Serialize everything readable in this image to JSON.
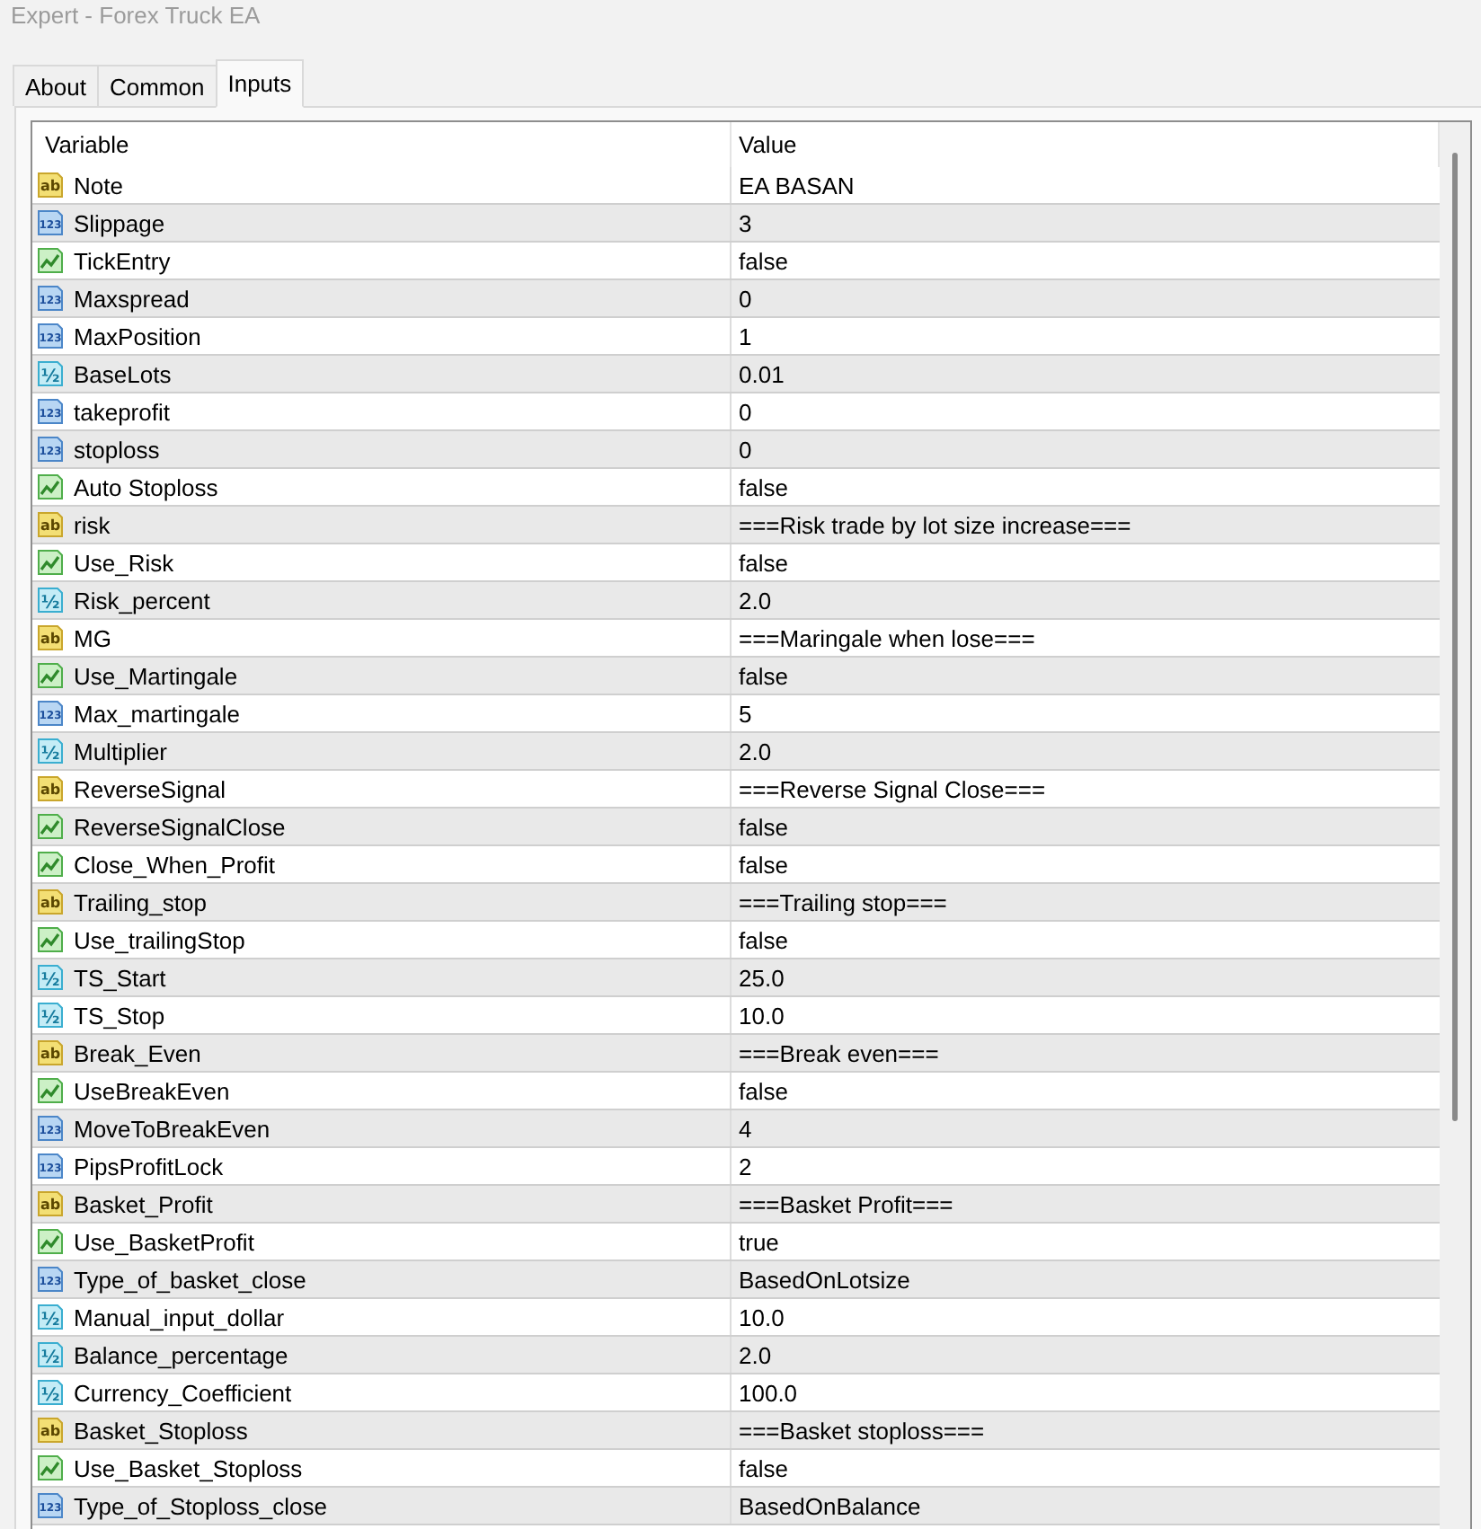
{
  "window": {
    "title": "Expert - Forex Truck EA"
  },
  "tabs": [
    {
      "label": "About",
      "selected": false
    },
    {
      "label": "Common",
      "selected": false
    },
    {
      "label": "Inputs",
      "selected": true
    }
  ],
  "table": {
    "columns": [
      "Variable",
      "Value"
    ],
    "rows": [
      {
        "kind": "string",
        "icon_text": "ab",
        "variable": "Note",
        "value": "EA BASAN"
      },
      {
        "kind": "int",
        "icon_text": "123",
        "variable": "Slippage",
        "value": "3"
      },
      {
        "kind": "bool",
        "variable": "TickEntry",
        "value": "false"
      },
      {
        "kind": "int",
        "icon_text": "123",
        "variable": "Maxspread",
        "value": "0"
      },
      {
        "kind": "int",
        "icon_text": "123",
        "variable": "MaxPosition",
        "value": "1"
      },
      {
        "kind": "double",
        "icon_text": "½",
        "variable": "BaseLots",
        "value": "0.01"
      },
      {
        "kind": "int",
        "icon_text": "123",
        "variable": "takeprofit",
        "value": "0"
      },
      {
        "kind": "int",
        "icon_text": "123",
        "variable": "stoploss",
        "value": "0"
      },
      {
        "kind": "bool",
        "variable": "Auto Stoploss",
        "value": "false"
      },
      {
        "kind": "string",
        "icon_text": "ab",
        "variable": "risk",
        "value": "===Risk trade by lot size increase==="
      },
      {
        "kind": "bool",
        "variable": "Use_Risk",
        "value": "false"
      },
      {
        "kind": "double",
        "icon_text": "½",
        "variable": "Risk_percent",
        "value": "2.0"
      },
      {
        "kind": "string",
        "icon_text": "ab",
        "variable": "MG",
        "value": "===Maringale when lose==="
      },
      {
        "kind": "bool",
        "variable": "Use_Martingale",
        "value": "false"
      },
      {
        "kind": "int",
        "icon_text": "123",
        "variable": "Max_martingale",
        "value": "5"
      },
      {
        "kind": "double",
        "icon_text": "½",
        "variable": "Multiplier",
        "value": "2.0"
      },
      {
        "kind": "string",
        "icon_text": "ab",
        "variable": "ReverseSignal",
        "value": "===Reverse Signal Close==="
      },
      {
        "kind": "bool",
        "variable": "ReverseSignalClose",
        "value": "false"
      },
      {
        "kind": "bool",
        "variable": "Close_When_Profit",
        "value": "false"
      },
      {
        "kind": "string",
        "icon_text": "ab",
        "variable": "Trailing_stop",
        "value": "===Trailing stop==="
      },
      {
        "kind": "bool",
        "variable": "Use_trailingStop",
        "value": "false"
      },
      {
        "kind": "double",
        "icon_text": "½",
        "variable": "TS_Start",
        "value": "25.0"
      },
      {
        "kind": "double",
        "icon_text": "½",
        "variable": "TS_Stop",
        "value": "10.0"
      },
      {
        "kind": "string",
        "icon_text": "ab",
        "variable": "Break_Even",
        "value": "===Break even==="
      },
      {
        "kind": "bool",
        "variable": "UseBreakEven",
        "value": "false"
      },
      {
        "kind": "int",
        "icon_text": "123",
        "variable": "MoveToBreakEven",
        "value": "4"
      },
      {
        "kind": "int",
        "icon_text": "123",
        "variable": "PipsProfitLock",
        "value": "2"
      },
      {
        "kind": "string",
        "icon_text": "ab",
        "variable": "Basket_Profit",
        "value": "===Basket Profit==="
      },
      {
        "kind": "bool",
        "variable": "Use_BasketProfit",
        "value": "true"
      },
      {
        "kind": "int",
        "icon_text": "123",
        "variable": "Type_of_basket_close",
        "value": "BasedOnLotsize"
      },
      {
        "kind": "double",
        "icon_text": "½",
        "variable": "Manual_input_dollar",
        "value": "10.0"
      },
      {
        "kind": "double",
        "icon_text": "½",
        "variable": "Balance_percentage",
        "value": "2.0"
      },
      {
        "kind": "double",
        "icon_text": "½",
        "variable": "Currency_Coefficient",
        "value": "100.0"
      },
      {
        "kind": "string",
        "icon_text": "ab",
        "variable": "Basket_Stoploss",
        "value": "===Basket stoploss==="
      },
      {
        "kind": "bool",
        "variable": "Use_Basket_Stoploss",
        "value": "false"
      },
      {
        "kind": "int",
        "icon_text": "123",
        "variable": "Type_of_Stoploss_close",
        "value": "BasedOnBalance"
      }
    ]
  }
}
